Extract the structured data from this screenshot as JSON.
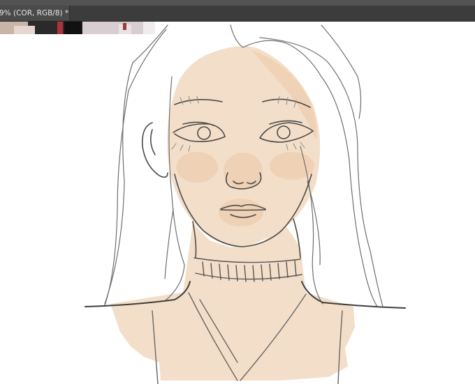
{
  "document_tab": {
    "title": "9% (COR, RGB/8) *",
    "close_glyph": "×"
  },
  "colors": {
    "tab_bar": "#3c3c3c",
    "active_tab": "#4a4a4a",
    "skin": "#f3dfc9",
    "sketch_line": "#555555"
  },
  "icons": [
    "close-icon"
  ]
}
